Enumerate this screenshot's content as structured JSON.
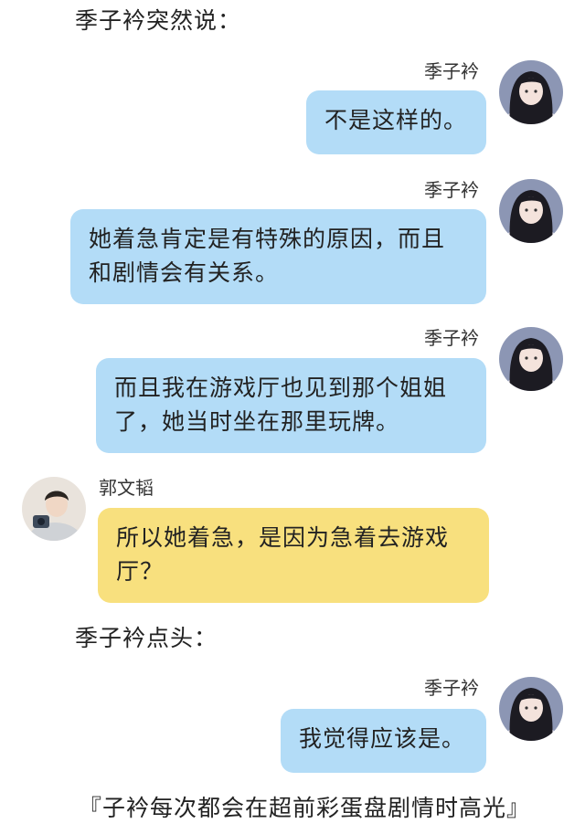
{
  "narration": {
    "line1": "季子衿突然说：",
    "line2": "季子衿点头："
  },
  "messages": [
    {
      "speaker": "季子衿",
      "text": "不是这样的。"
    },
    {
      "speaker": "季子衿",
      "text_line1": "她着急肯定是有特殊的原因，而且",
      "text_line2": "和剧情会有关系。"
    },
    {
      "speaker": "季子衿",
      "text_line1": "而且我在游戏厅也见到那个姐姐",
      "text_line2": "了，她当时坐在那里玩牌。"
    },
    {
      "speaker": "郭文韬",
      "text_line1": "所以她着急，是因为急着去游戏",
      "text_line2": "厅？"
    },
    {
      "speaker": "季子衿",
      "text": "我觉得应该是。"
    }
  ],
  "footer": "『子衿每次都会在超前彩蛋盘剧情时高光』",
  "colors": {
    "bubble_right": "#b3dcf7",
    "bubble_left": "#f8e07e"
  },
  "icons": {
    "avatar_right": "avatar-girl-icon",
    "avatar_left": "avatar-boy-icon"
  }
}
